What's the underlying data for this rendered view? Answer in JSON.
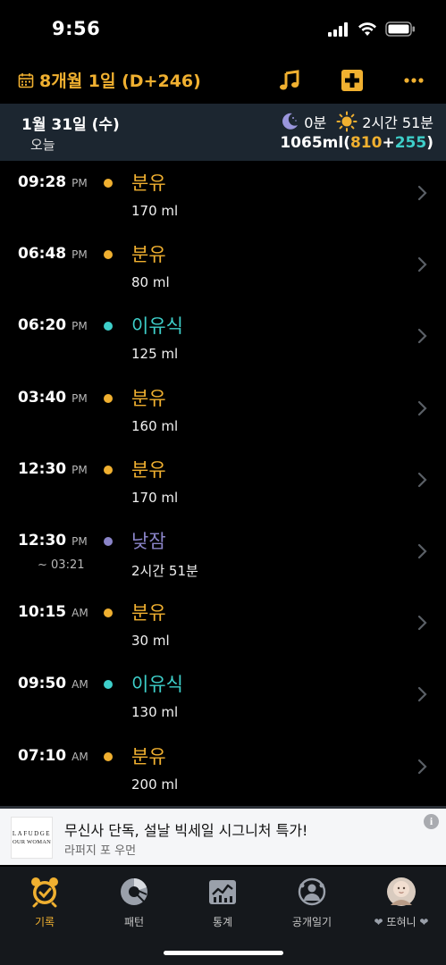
{
  "status": {
    "time": "9:56"
  },
  "header": {
    "date_title": "8개월 1일 (D+246)"
  },
  "summary": {
    "date": "1월 31일 (수)",
    "today_label": "오늘",
    "night_sleep": "0분",
    "day_sleep": "2시간 51분",
    "total": "1065ml",
    "total_formula": "810",
    "total_solid": "255"
  },
  "colors": {
    "formula": "#f0b030",
    "solid": "#3ecfca",
    "nap": "#8a84c8",
    "accent": "#f0b030"
  },
  "records": [
    {
      "time": "09:28",
      "ampm": "PM",
      "end": "",
      "type": "분유",
      "kind": "formula",
      "value": "170 ml"
    },
    {
      "time": "06:48",
      "ampm": "PM",
      "end": "",
      "type": "분유",
      "kind": "formula",
      "value": "80 ml"
    },
    {
      "time": "06:20",
      "ampm": "PM",
      "end": "",
      "type": "이유식",
      "kind": "solid",
      "value": "125 ml"
    },
    {
      "time": "03:40",
      "ampm": "PM",
      "end": "",
      "type": "분유",
      "kind": "formula",
      "value": "160 ml"
    },
    {
      "time": "12:30",
      "ampm": "PM",
      "end": "",
      "type": "분유",
      "kind": "formula",
      "value": "170 ml"
    },
    {
      "time": "12:30",
      "ampm": "PM",
      "end": "~ 03:21",
      "type": "낮잠",
      "kind": "nap",
      "value": "2시간 51분"
    },
    {
      "time": "10:15",
      "ampm": "AM",
      "end": "",
      "type": "분유",
      "kind": "formula",
      "value": "30 ml"
    },
    {
      "time": "09:50",
      "ampm": "AM",
      "end": "",
      "type": "이유식",
      "kind": "solid",
      "value": "130 ml"
    },
    {
      "time": "07:10",
      "ampm": "AM",
      "end": "",
      "type": "분유",
      "kind": "formula",
      "value": "200 ml"
    }
  ],
  "ad": {
    "logo_line1": "LAFUDGE",
    "logo_line2": "OUR WOMAN",
    "title": "무신사 단독, 설날 빅세일 시그니처 특가!",
    "subtitle": "라퍼지 포 우먼",
    "info": "i"
  },
  "tabs": [
    {
      "label": "기록",
      "icon": "alarm-clock-icon",
      "active": true
    },
    {
      "label": "패턴",
      "icon": "pattern-chart-icon",
      "active": false
    },
    {
      "label": "통계",
      "icon": "statistics-icon",
      "active": false
    },
    {
      "label": "공개일기",
      "icon": "public-diary-icon",
      "active": false
    },
    {
      "label": "또혀니",
      "icon": "baby-profile-avatar",
      "active": false
    }
  ]
}
